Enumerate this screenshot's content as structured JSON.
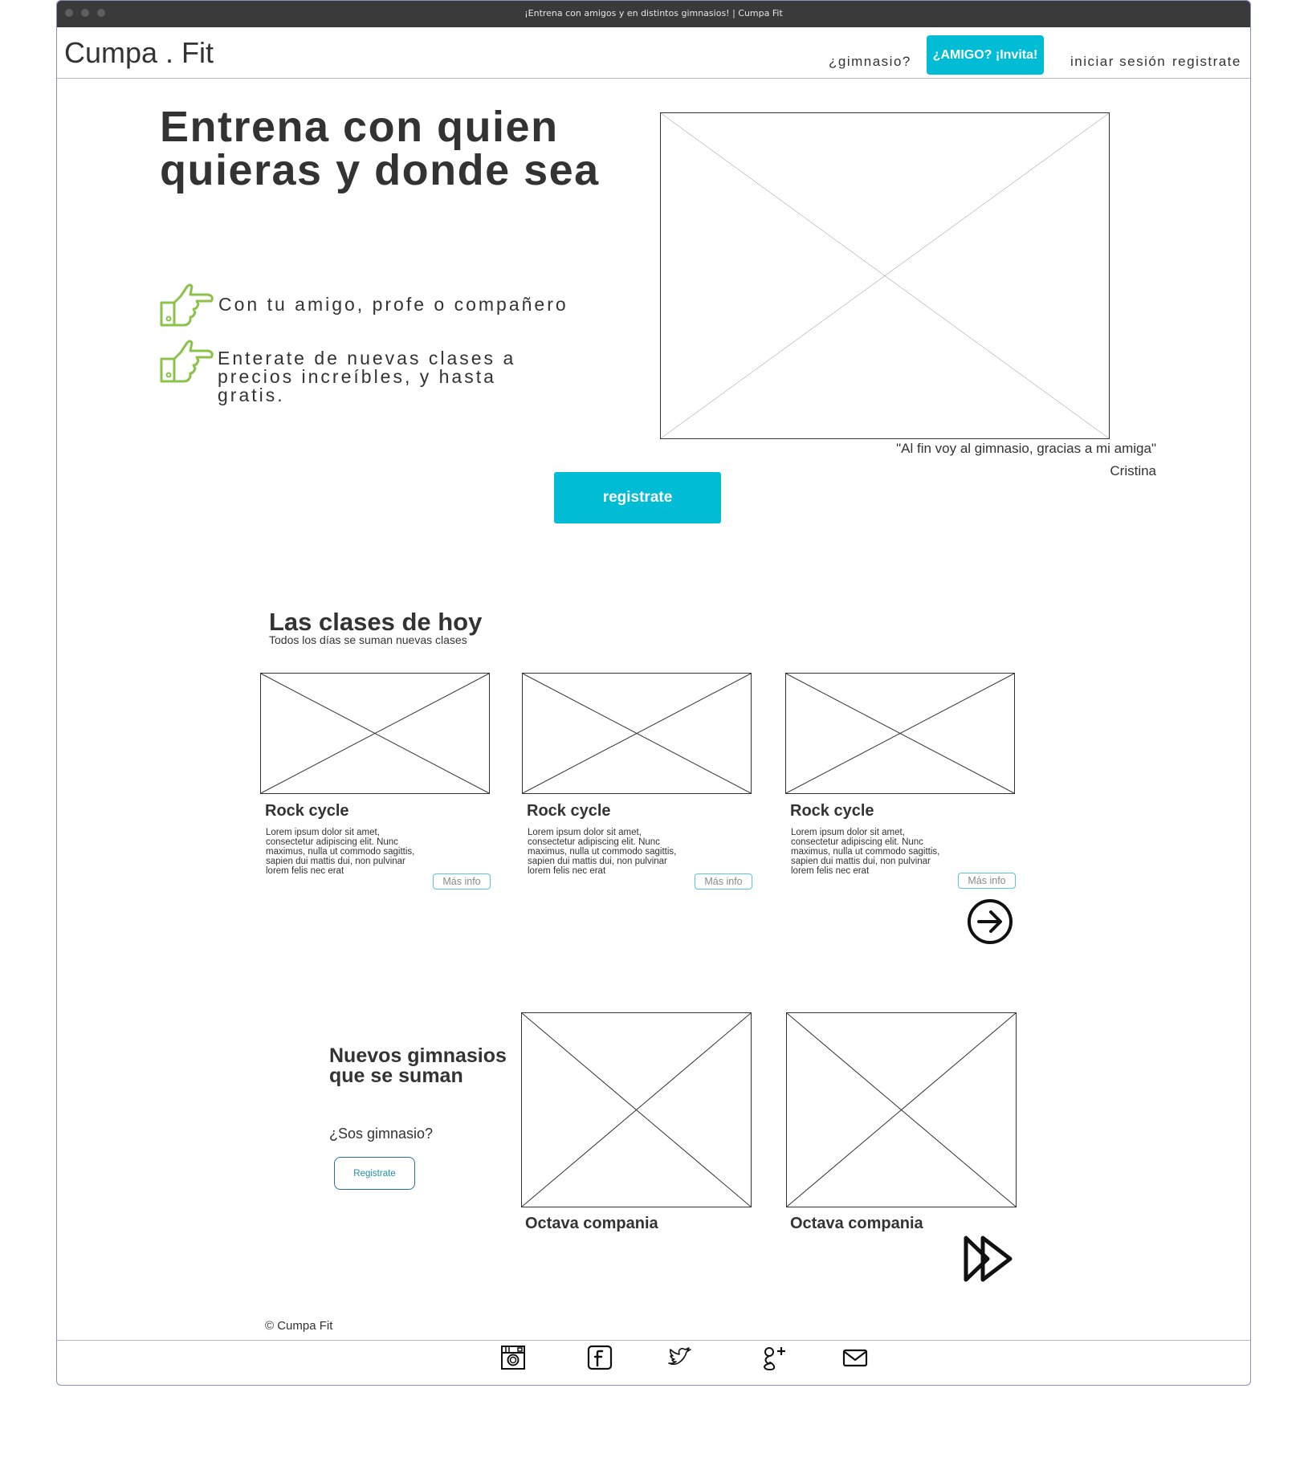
{
  "window": {
    "title": "¡Entrena con amigos y en distintos gimnasios! | Cumpa Fit"
  },
  "header": {
    "brand": "Cumpa . Fit",
    "nav": {
      "gym_link": "¿gimnasio?",
      "invite_button": "¿AMIGO? ¡Invita!",
      "login_link": "iniciar sesión",
      "register_link": "registrate"
    }
  },
  "hero": {
    "title": "Entrena con quien quieras y donde sea",
    "bullets": [
      {
        "icon": "pointing-hand-icon",
        "text": "Con tu amigo, profe o compañero"
      },
      {
        "icon": "pointing-hand-icon",
        "text": "Enterate de nuevas clases a precios increíbles, y hasta gratis."
      }
    ],
    "quote": "\"Al fin voy al gimnasio, gracias a mi amiga\"",
    "quote_author": "Cristina",
    "register_button": "registrate"
  },
  "classes": {
    "title": "Las clases de hoy",
    "subtitle": "Todos los días se suman nuevas clases",
    "cards": [
      {
        "title": "Rock cycle",
        "description": "Lorem ipsum dolor sit amet, consectetur adipiscing elit. Nunc maximus, nulla ut commodo sagittis, sapien dui mattis dui, non pulvinar lorem felis nec erat",
        "button": "Más info"
      },
      {
        "title": "Rock cycle",
        "description": "Lorem ipsum dolor sit amet, consectetur adipiscing elit. Nunc maximus, nulla ut commodo sagittis, sapien dui mattis dui, non pulvinar lorem felis nec erat",
        "button": "Más info"
      },
      {
        "title": "Rock cycle",
        "description": "Lorem ipsum dolor sit amet, consectetur adipiscing elit. Nunc maximus, nulla ut commodo sagittis, sapien dui mattis dui, non pulvinar lorem felis nec erat",
        "button": "Más info"
      }
    ],
    "next_icon": "arrow-right-circle-icon"
  },
  "gyms": {
    "title": "Nuevos gimnasios que se suman",
    "question": "¿Sos gimnasio?",
    "register_button": "Registrate",
    "cards": [
      {
        "title": "Octava compania"
      },
      {
        "title": "Octava compania"
      }
    ],
    "next_icon": "fast-forward-icon"
  },
  "footer": {
    "copyright": "© Cumpa Fit",
    "icons": [
      "instagram-icon",
      "facebook-icon",
      "twitter-icon",
      "google-plus-icon",
      "mail-icon"
    ]
  },
  "colors": {
    "accent": "#00bcd4",
    "bullet_icon": "#8bc34a",
    "text": "#333333",
    "window_border": "#8a8fc0",
    "titlebar": "#3a3a3a"
  }
}
